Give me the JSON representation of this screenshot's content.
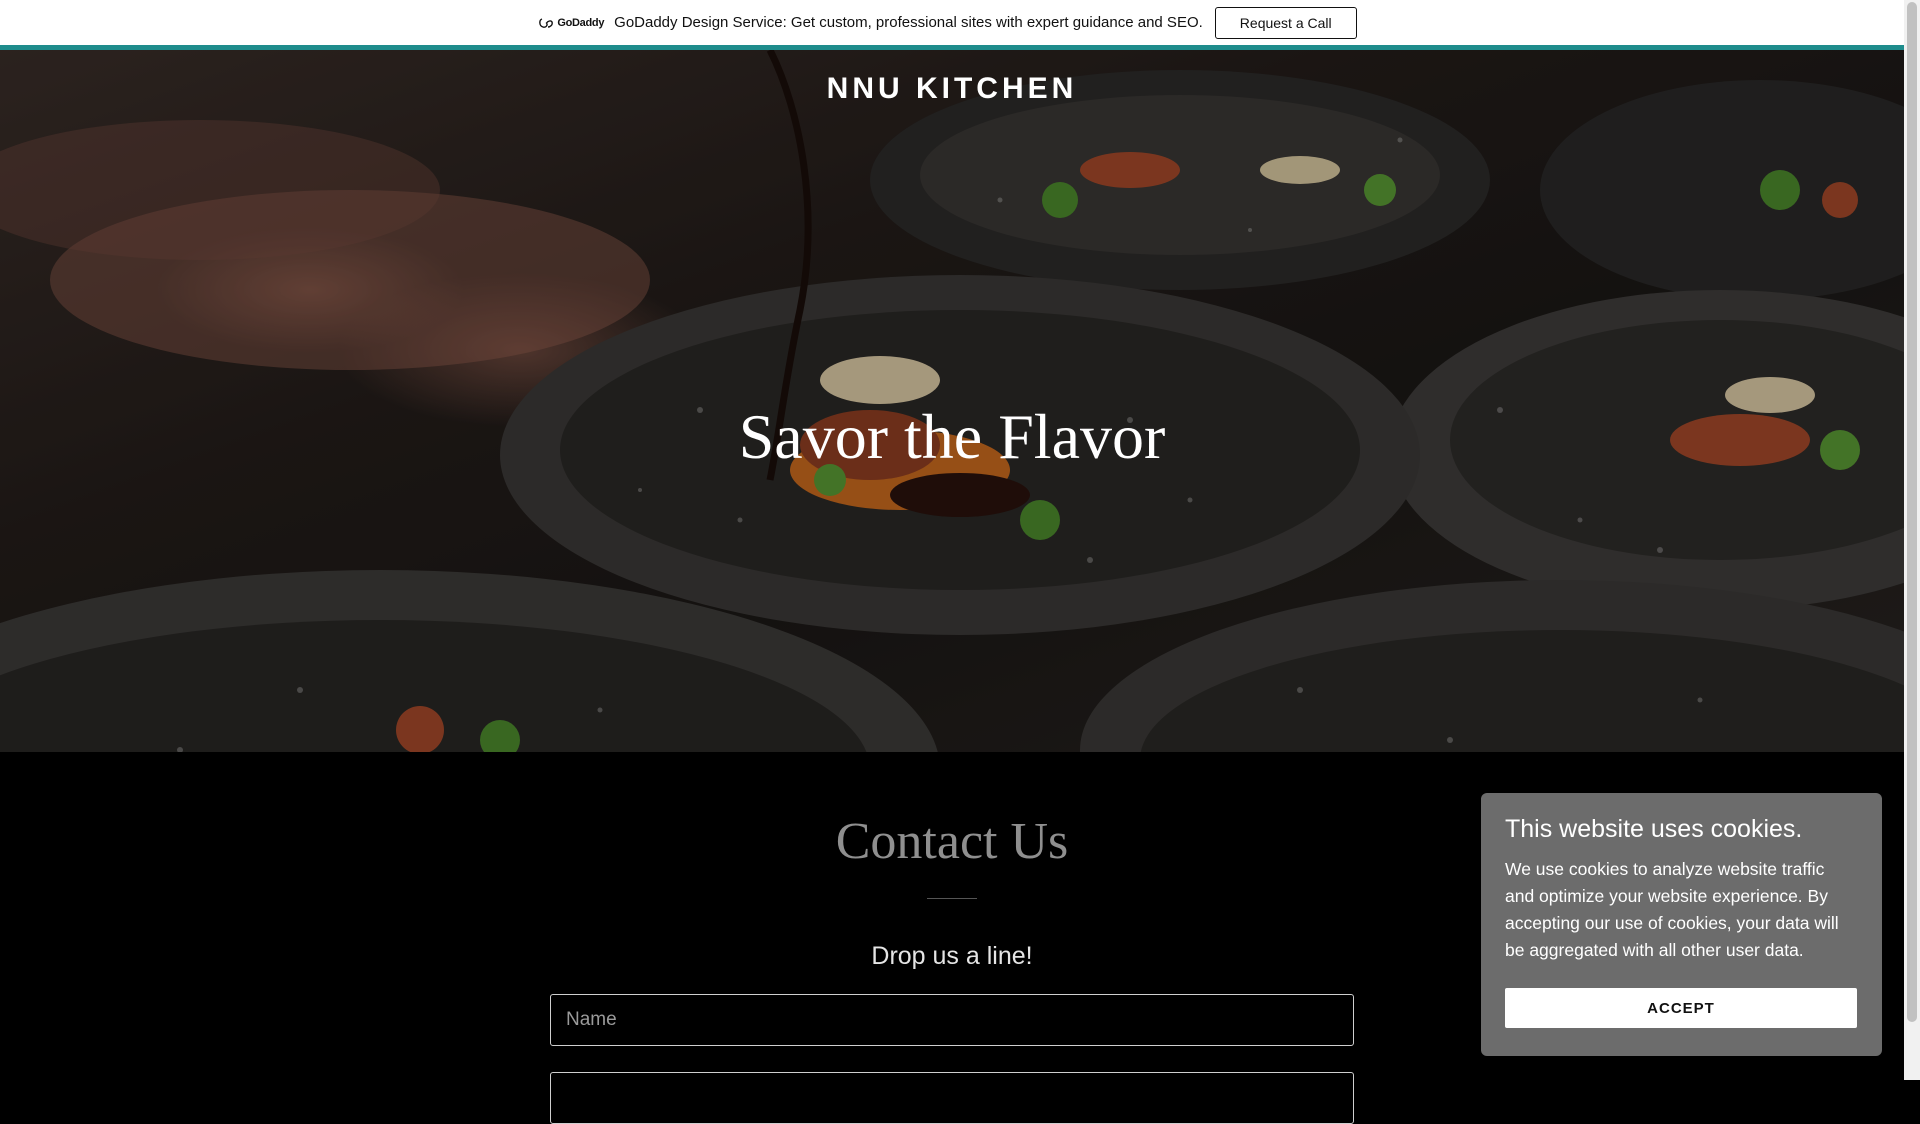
{
  "promo": {
    "logo_text": "GoDaddy",
    "message": "GoDaddy Design Service: Get custom, professional sites with expert guidance and SEO.",
    "button_label": "Request a Call",
    "accent_color": "#1e8c8c"
  },
  "header": {
    "site_title": "NNU KITCHEN"
  },
  "hero": {
    "headline": "Savor the Flavor",
    "background_subject": "plated dishes with sauce being drizzled"
  },
  "contact": {
    "title": "Contact Us",
    "subtitle": "Drop us a line!",
    "fields": {
      "name_placeholder": "Name",
      "email_placeholder": ""
    }
  },
  "cookie_banner": {
    "title": "This website uses cookies.",
    "body": "We use cookies to analyze website traffic and optimize your website experience. By accepting our use of cookies, your data will be aggregated with all other user data.",
    "accept_label": "ACCEPT"
  }
}
